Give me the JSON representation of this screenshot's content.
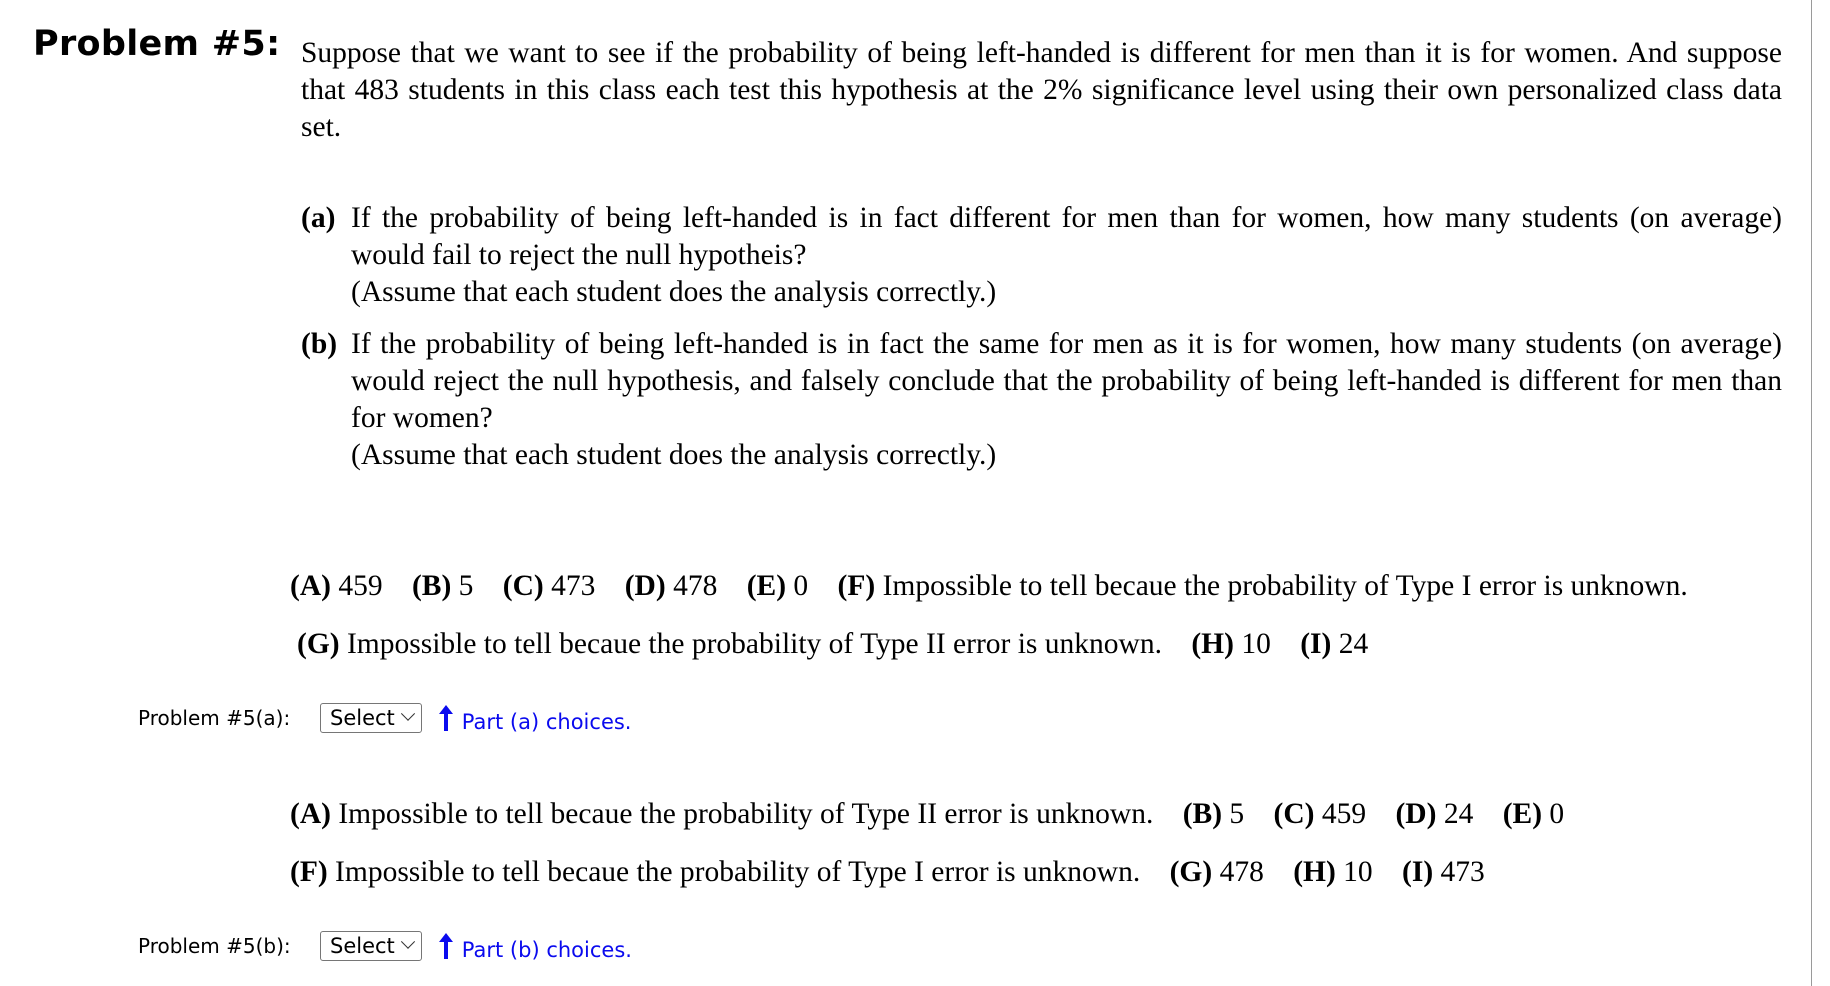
{
  "problem": {
    "title": "Problem #5:",
    "intro": "Suppose that we want to see if the probability of being left-handed is different for men than it is for women. And suppose that 483 students in this class each test this hypothesis at the 2% significance level using their own personalized class data set.",
    "parts": [
      {
        "label": "(a)",
        "text": "If the probability of being left-handed is in fact different for men than for women, how many students (on average) would fail to reject the null hypotheis?",
        "note": "(Assume that each student does the analysis correctly.)"
      },
      {
        "label": "(b)",
        "text": "If the probability of being left-handed is in fact the same for men as it is for women, how many students (on average) would reject the null hypothesis, and falsely conclude that the probability of being left-handed is different for men than for women?",
        "note": "(Assume that each student does the analysis correctly.)"
      }
    ]
  },
  "choices_a": [
    [
      {
        "key": "(A)",
        "value": "459"
      },
      {
        "key": "(B)",
        "value": "5"
      },
      {
        "key": "(C)",
        "value": "473"
      },
      {
        "key": "(D)",
        "value": "478"
      },
      {
        "key": "(E)",
        "value": "0"
      },
      {
        "key": "(F)",
        "value": "Impossible to tell becaue the probability of Type I error is unknown."
      }
    ],
    [
      {
        "key": "(G)",
        "value": "Impossible to tell becaue the probability of Type II error is unknown."
      },
      {
        "key": "(H)",
        "value": "10"
      },
      {
        "key": "(I)",
        "value": "24"
      }
    ]
  ],
  "choices_b": [
    [
      {
        "key": "(A)",
        "value": "Impossible to tell becaue the probability of Type II error is unknown."
      },
      {
        "key": "(B)",
        "value": "5"
      },
      {
        "key": "(C)",
        "value": "459"
      },
      {
        "key": "(D)",
        "value": "24"
      },
      {
        "key": "(E)",
        "value": "0"
      }
    ],
    [
      {
        "key": "(F)",
        "value": "Impossible to tell becaue the probability of Type I error is unknown."
      },
      {
        "key": "(G)",
        "value": "478"
      },
      {
        "key": "(H)",
        "value": "10"
      },
      {
        "key": "(I)",
        "value": "473"
      }
    ]
  ],
  "answers": [
    {
      "label": "Problem #5(a):",
      "select_value": "Select",
      "hint": "Part (a) choices.",
      "icon": "arrow-up-icon"
    },
    {
      "label": "Problem #5(b):",
      "select_value": "Select",
      "hint": "Part (b) choices.",
      "icon": "arrow-up-icon"
    }
  ],
  "colors": {
    "hint_link": "#0a0aee",
    "border": "#9a9a9a"
  }
}
